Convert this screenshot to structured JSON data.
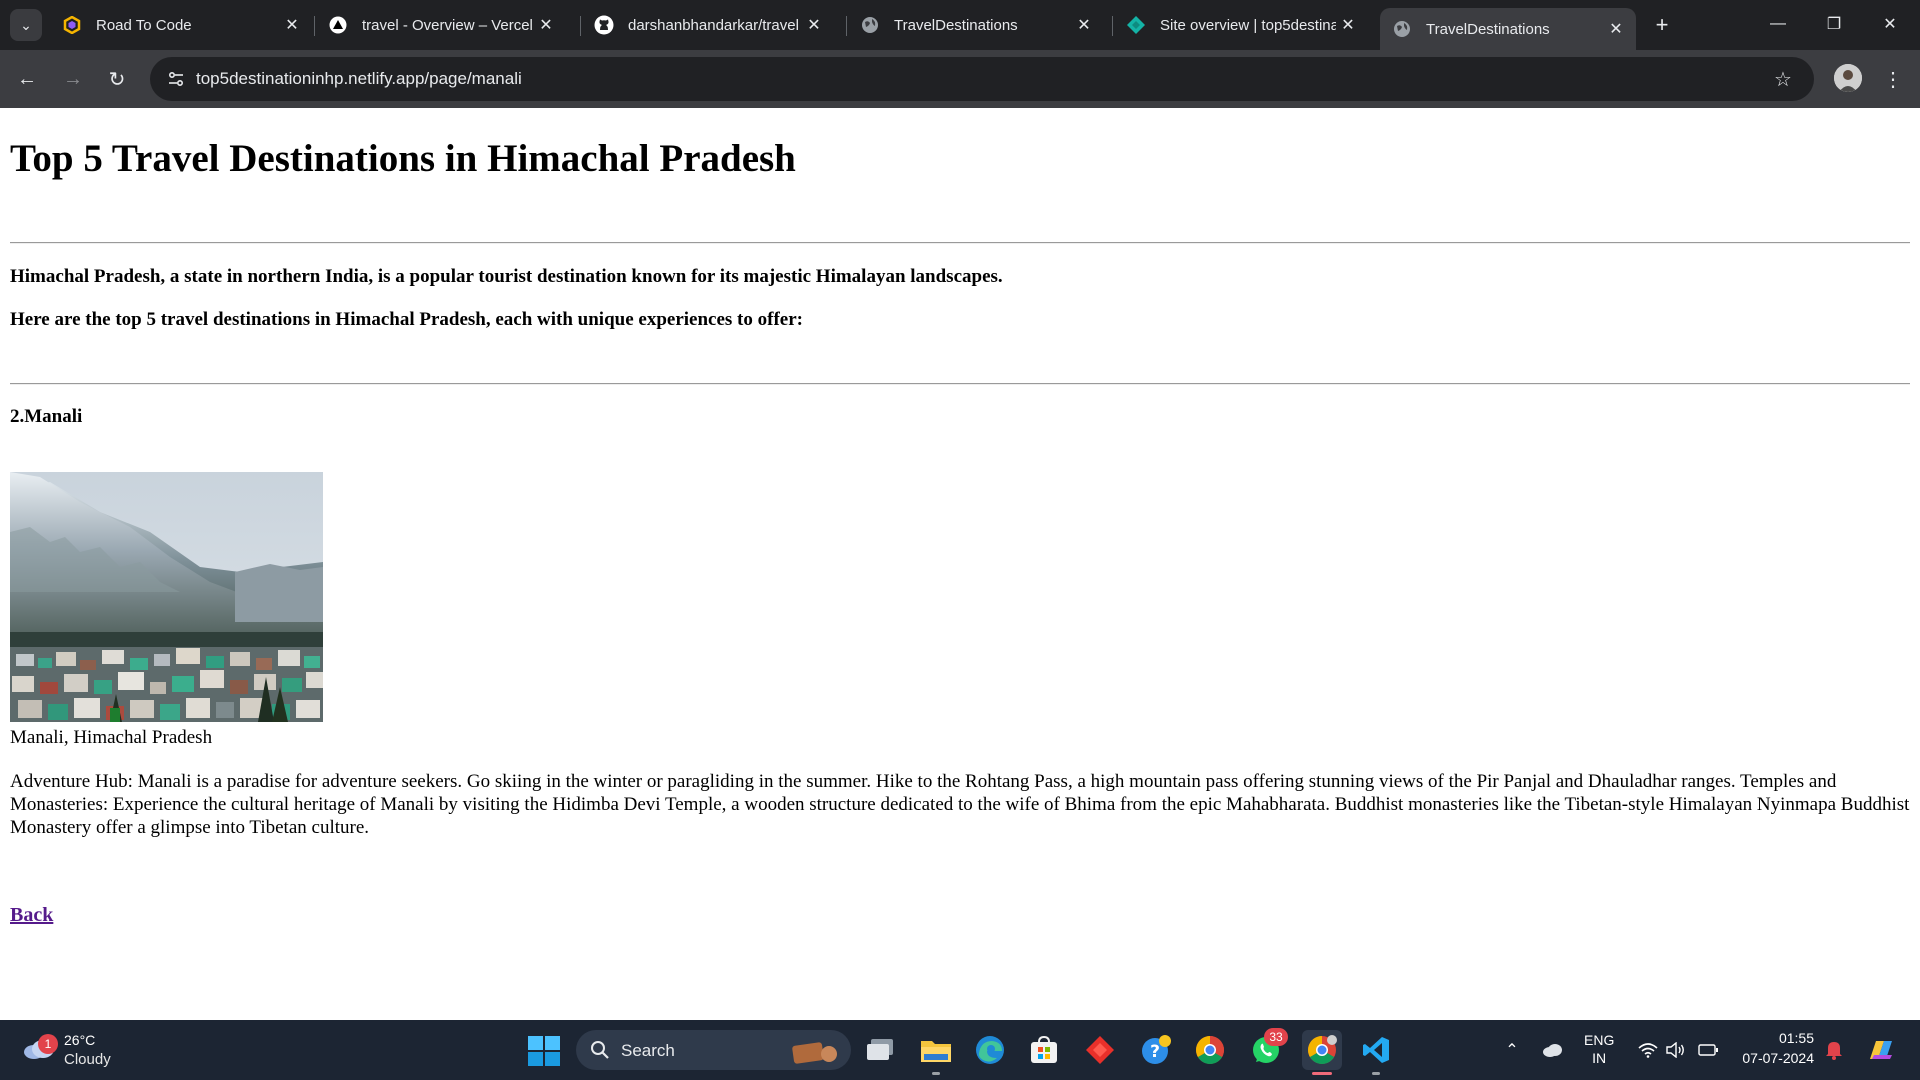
{
  "browser": {
    "tabs": [
      {
        "title": "Road To Code",
        "favicon": "road-to-code-icon"
      },
      {
        "title": "travel - Overview – Vercel",
        "favicon": "vercel-icon"
      },
      {
        "title": "darshanbhandarkar/travel",
        "favicon": "github-icon"
      },
      {
        "title": "TravelDestinations",
        "favicon": "globe-icon"
      },
      {
        "title": "Site overview | top5destina",
        "favicon": "netlify-icon"
      },
      {
        "title": "TravelDestinations",
        "favicon": "globe-icon",
        "active": true
      }
    ],
    "url": "top5destinationinhp.netlify.app/page/manali"
  },
  "page": {
    "title": "Top 5 Travel Destinations in Himachal Pradesh",
    "intro_1": "Himachal Pradesh, a state in northern India, is a popular tourist destination known for its majestic Himalayan landscapes.",
    "intro_2": "Here are the top 5 travel destinations in Himachal Pradesh, each with unique experiences to offer:",
    "destination_heading": "2.Manali",
    "image_caption": "Manali, Himachal Pradesh",
    "description": "Adventure Hub: Manali is a paradise for adventure seekers. Go skiing in the winter or paragliding in the summer. Hike to the Rohtang Pass, a high mountain pass offering stunning views of the Pir Panjal and Dhauladhar ranges. Temples and Monasteries: Experience the cultural heritage of Manali by visiting the Hidimba Devi Temple, a wooden structure dedicated to the wife of Bhima from the epic Mahabharata. Buddhist monasteries like the Tibetan-style Himalayan Nyinmapa Buddhist Monastery offer a glimpse into Tibetan culture.",
    "back_label": "Back",
    "link_color": "#551a8b"
  },
  "taskbar": {
    "weather": {
      "temp": "26°C",
      "condition": "Cloudy",
      "badge": "1"
    },
    "search_label": "Search",
    "whatsapp_badge": "33",
    "language": {
      "line1": "ENG",
      "line2": "IN"
    },
    "clock": {
      "time": "01:55",
      "date": "07-07-2024"
    },
    "accent": "#1c2533"
  }
}
